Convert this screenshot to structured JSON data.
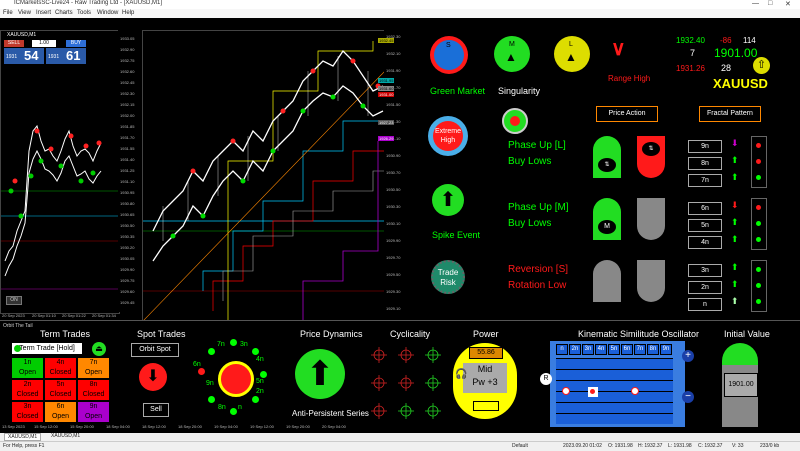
{
  "window": {
    "title": "ICMarketsSC-Live24 - Raw Trading Ltd - [XAUUSD,M1]",
    "minimize": "—",
    "maximize": "□",
    "close": "✕"
  },
  "menu": [
    "File",
    "View",
    "Insert",
    "Charts",
    "Tools",
    "Window",
    "Help"
  ],
  "left_chart": {
    "title": "XAUUSD,M1",
    "sell_label": "SELL",
    "buy_label": "BUY",
    "lot": "1.00",
    "sell_price_small": "1931",
    "sell_price_big": "54",
    "buy_price_small": "1931",
    "buy_price_big": "61",
    "on_label": "ON",
    "price_labels": [
      "1933.05",
      "1932.90",
      "1932.75",
      "1932.60",
      "1932.45",
      "1932.30",
      "1932.15",
      "1932.00",
      "1931.85",
      "1931.70",
      "1931.55",
      "1931.40",
      "1931.25",
      "1931.10",
      "1930.95",
      "1930.80",
      "1930.65",
      "1930.50",
      "1930.35",
      "1930.20",
      "1930.05",
      "1929.90",
      "1929.75",
      "1929.60",
      "1929.45",
      "1929.30"
    ],
    "time_labels": [
      "20 Sep 2023",
      "20 Sep 01:10",
      "20 Sep 01:22",
      "20 Sep 01:34"
    ]
  },
  "main_chart": {
    "price_labels": [
      "1932.30",
      "1932.10",
      "1931.90",
      "1931.70",
      "1931.50",
      "1931.30",
      "1931.10",
      "1930.90",
      "1930.70",
      "1930.50",
      "1930.30",
      "1930.10",
      "1929.90",
      "1929.70",
      "1929.50",
      "1929.30",
      "1929.10"
    ],
    "tag_labels": [
      "1932.45",
      "1931.95",
      "1931.60",
      "1931.00",
      "1927.23",
      "1926.29"
    ],
    "time_labels": [
      "13 Sep 2023",
      "15 Sep 12:00",
      "15 Sep 20:00",
      "18 Sep 04:00",
      "18 Sep 12:00",
      "18 Sep 20:00",
      "19 Sep 04:00",
      "19 Sep 12:00",
      "19 Sep 20:00",
      "20 Sep 04:00"
    ]
  },
  "right_panel": {
    "s_label": "S",
    "m_label": "M",
    "l_label": "L",
    "price_high": "1932.40",
    "change": "-86",
    "spread": "114",
    "count": "7",
    "bid_big": "1901.00",
    "price_low": "1931.26",
    "timer": "28",
    "range_high": "Range High",
    "symbol": "XAUUSD",
    "green_market": "Green Market",
    "singularity": "Singularity",
    "extreme_high": "Extreme\nHigh",
    "spike_event": "Spike Event",
    "trade_risk": "Trade\nRisk",
    "phase1_line1": "Phase Up [L]",
    "phase1_line2": "Buy Lows",
    "phase2_line1": "Phase Up [M]",
    "phase2_line2": "Buy Lows",
    "phase3_line1": "Reversion [S]",
    "phase3_line2": "Rotation Low",
    "price_action_btn": "Price Action",
    "fractal_btn": "Fractal Pattern",
    "m_button": "M",
    "fractals": [
      "9n",
      "8n",
      "7n",
      "6n",
      "5n",
      "4n",
      "3n",
      "2n",
      "n"
    ]
  },
  "bottom": {
    "orbit_label": "Orbit The Tail",
    "term_trades_title": "Term Trades",
    "term_hold_btn": "Term Trade [Hold]",
    "term_cells": [
      {
        "text": "1n\nOpen",
        "color": "#00cc00",
        "fg": "#000"
      },
      {
        "text": "4n\nClosed",
        "color": "#ff0000",
        "fg": "#000"
      },
      {
        "text": "7n\nOpen",
        "color": "#ff8800",
        "fg": "#000"
      },
      {
        "text": "2n\nClosed",
        "color": "#ff0000",
        "fg": "#000"
      },
      {
        "text": "5n\nClosed",
        "color": "#ff0000",
        "fg": "#000"
      },
      {
        "text": "8n\nClosed",
        "color": "#ff0000",
        "fg": "#000"
      },
      {
        "text": "3n\nClosed",
        "color": "#ff0000",
        "fg": "#000"
      },
      {
        "text": "6n\nOpen",
        "color": "#ff8800",
        "fg": "#000"
      },
      {
        "text": "9n\nOpen",
        "color": "#aa00cc",
        "fg": "#000"
      }
    ],
    "spot_title": "Spot Trades",
    "orbit_spot_btn": "Orbit Spot",
    "sell_btn": "Sell",
    "orbit_labels": [
      "n",
      "2n",
      "3n",
      "4n",
      "5n",
      "6n",
      "7n",
      "8n",
      "9n"
    ],
    "dynamics_title": "Price Dynamics",
    "anti_persistent": "Anti-Persistent Series",
    "cyclicality_title": "Cyclicality",
    "power_title": "Power",
    "power_value": "55.86",
    "power_mid": "Mid",
    "power_pw": "Pw +3",
    "kso_title": "Kinematic Similitude Oscillator",
    "kso_headers": [
      "n",
      "2n",
      "3n",
      "4n",
      "5n",
      "6n",
      "7n",
      "8n",
      "9n"
    ],
    "r_label": "R",
    "plus": "+",
    "minus": "−",
    "initial_title": "Initial Value",
    "initial_value": "1901.00"
  },
  "tabs": [
    "XAUUSD,M1",
    "XAUUSD,M1"
  ],
  "status": {
    "help": "For Help, press F1",
    "profile": "Default",
    "datetime": "2023.09.20 01:02",
    "open": "O: 1931.98",
    "high": "H: 1932.37",
    "low": "L: 1931.98",
    "close": "C: 1932.37",
    "volume": "V: 33",
    "traffic": "233/0 kb"
  },
  "colors": {
    "market_green": "#00ff00",
    "alert_red": "#ff0000",
    "panel_yellow": "#ffff00",
    "grid_blue": "#1a5fd8"
  }
}
